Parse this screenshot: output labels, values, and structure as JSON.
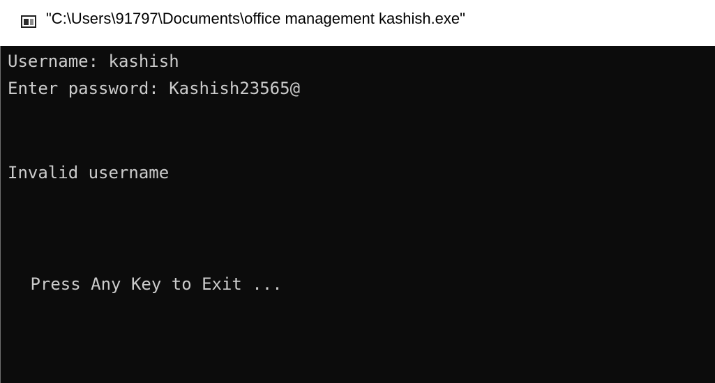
{
  "window": {
    "title": "\"C:\\Users\\91797\\Documents\\office management kashish.exe\"",
    "icon": "console-app-icon"
  },
  "console": {
    "lines": [
      "Username: kashish",
      "Enter password: Kashish23565@",
      "Invalid username",
      " Press Any Key to Exit ..."
    ]
  },
  "colors": {
    "console_background": "#0c0c0c",
    "console_text": "#cccccc",
    "titlebar_background": "#ffffff"
  }
}
